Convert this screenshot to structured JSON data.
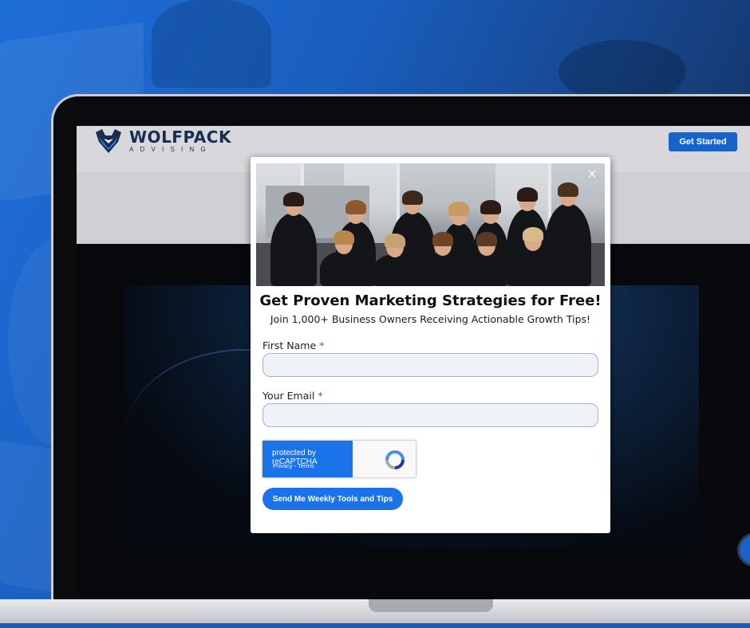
{
  "site": {
    "logo_name": "WOLFPACK",
    "logo_sub": "ADVISING",
    "cta_label": "Get Started"
  },
  "popup": {
    "close_glyph": "×",
    "title": "Get Proven Marketing Strategies for Free!",
    "subtitle": "Join 1,000+ Business Owners Receiving Actionable Growth Tips!",
    "fields": [
      {
        "label": "First Name",
        "required_mark": "*",
        "value": "",
        "placeholder": ""
      },
      {
        "label": "Your Email",
        "required_mark": "*",
        "value": "",
        "placeholder": ""
      }
    ],
    "recaptcha": {
      "text": "protected by reCAPTCHA",
      "links": "Privacy - Terms"
    },
    "submit_label": "Send Me Weekly Tools and Tips"
  },
  "colors": {
    "accent": "#1a73e8",
    "brand_navy": "#1b2d4f",
    "background_blue": "#1e6ed8"
  },
  "icons": {
    "logo": "wolf-logo-icon",
    "close": "close-icon",
    "recaptcha": "recaptcha-logo-icon",
    "chat": "chat-icon"
  }
}
